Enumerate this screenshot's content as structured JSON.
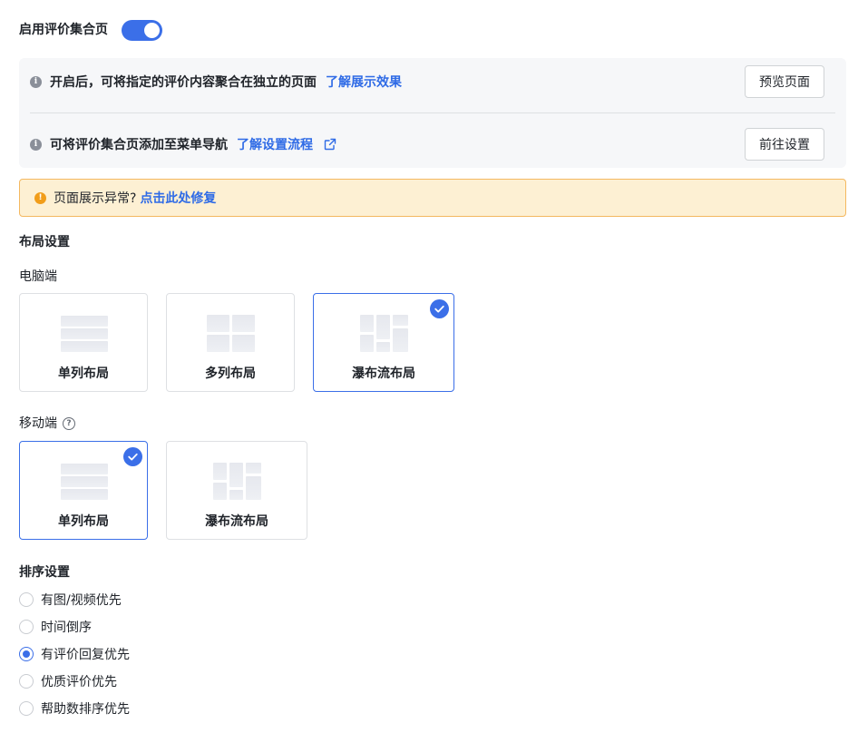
{
  "header": {
    "enable_label": "启用评价集合页",
    "enabled": true
  },
  "info": {
    "row1_text": "开启后，可将指定的评价内容聚合在独立的页面",
    "row1_link": "了解展示效果",
    "row1_button": "预览页面",
    "row2_text": "可将评价集合页添加至菜单导航",
    "row2_link": "了解设置流程",
    "row2_button": "前往设置"
  },
  "warning": {
    "text": "页面展示异常?",
    "link": "点击此处修复"
  },
  "layout": {
    "title": "布局设置",
    "desktop": {
      "title": "电脑端",
      "options": [
        {
          "label": "单列布局",
          "selected": false
        },
        {
          "label": "多列布局",
          "selected": false
        },
        {
          "label": "瀑布流布局",
          "selected": true
        }
      ]
    },
    "mobile": {
      "title": "移动端",
      "options": [
        {
          "label": "单列布局",
          "selected": true
        },
        {
          "label": "瀑布流布局",
          "selected": false
        }
      ]
    }
  },
  "sort": {
    "title": "排序设置",
    "options": [
      {
        "label": "有图/视频优先",
        "checked": false
      },
      {
        "label": "时间倒序",
        "checked": false
      },
      {
        "label": "有评价回复优先",
        "checked": true
      },
      {
        "label": "优质评价优先",
        "checked": false
      },
      {
        "label": "帮助数排序优先",
        "checked": false
      }
    ]
  },
  "colors": {
    "accent": "#3b6fe8",
    "link": "#2f6be6",
    "warning_bg": "#fdf0d3",
    "warning_border": "#f4b860"
  }
}
